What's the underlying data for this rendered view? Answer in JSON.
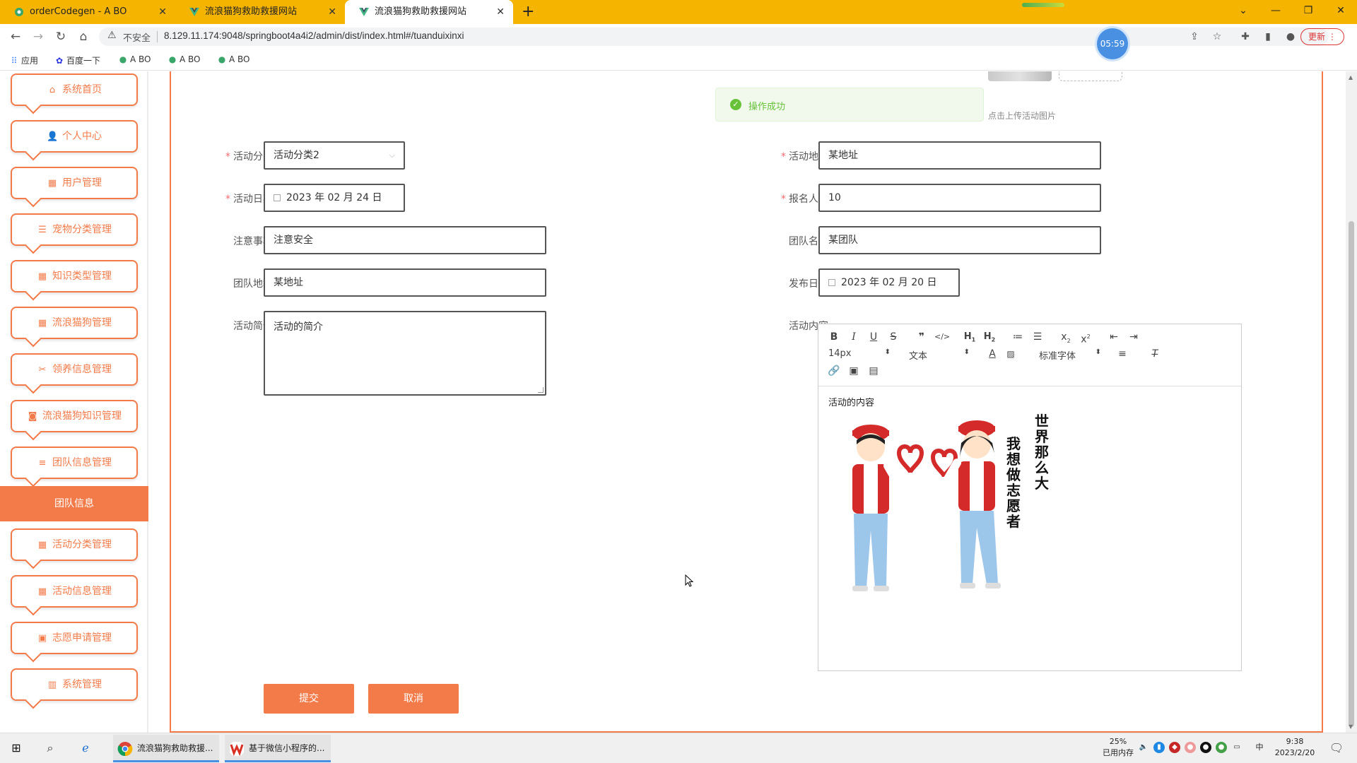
{
  "browser": {
    "tabs": [
      {
        "title": "orderCodegen - A BO"
      },
      {
        "title": "流浪猫狗救助救援网站"
      },
      {
        "title": "流浪猫狗救助救援网站"
      }
    ],
    "new_tab_symbol": "+",
    "insecure_label": "不安全",
    "url": "8.129.11.174:9048/springboot4a4i2/admin/dist/index.html#/tuanduixinxi",
    "timer": "05:59",
    "update_label": "更新",
    "bookmarks": [
      "应用",
      "百度一下",
      "A BO",
      "A BO",
      "A BO"
    ]
  },
  "sidebar": {
    "items": [
      {
        "label": "系统首页",
        "icon": "home-icon"
      },
      {
        "label": "个人中心",
        "icon": "user-icon"
      },
      {
        "label": "用户管理",
        "icon": "grid-icon"
      },
      {
        "label": "宠物分类管理",
        "icon": "list-icon"
      },
      {
        "label": "知识类型管理",
        "icon": "grid-icon"
      },
      {
        "label": "流浪猫狗管理",
        "icon": "grid-icon"
      },
      {
        "label": "领养信息管理",
        "icon": "ticket-icon"
      },
      {
        "label": "流浪猫狗知识管理",
        "icon": "camera-icon"
      },
      {
        "label": "团队信息管理",
        "icon": "sliders-icon"
      }
    ],
    "active_item": "团队信息",
    "items_after": [
      {
        "label": "活动分类管理",
        "icon": "grid-icon"
      },
      {
        "label": "活动信息管理",
        "icon": "grid-icon"
      },
      {
        "label": "志愿申请管理",
        "icon": "clipboard-icon"
      },
      {
        "label": "系统管理",
        "icon": "bar-chart-icon"
      }
    ],
    "accent_color": "#f37b4a"
  },
  "toast": {
    "message": "操作成功",
    "color": "#67c23a"
  },
  "upload": {
    "hint": "点击上传活动图片"
  },
  "form": {
    "activity_category": {
      "label": "活动分类",
      "value": "活动分类2"
    },
    "activity_date": {
      "label": "活动日期",
      "value": "2023 年 02 月 24 日"
    },
    "notes": {
      "label": "注意事项",
      "value": "注意安全"
    },
    "team_address": {
      "label": "团队地址",
      "value": "某地址"
    },
    "activity_intro": {
      "label": "活动简介",
      "value": "活动的简介"
    },
    "activity_address": {
      "label": "活动地址",
      "value": "某地址"
    },
    "signup_count": {
      "label": "报名人数",
      "value": "10"
    },
    "team_name": {
      "label": "团队名称",
      "value": "某团队"
    },
    "publish_date": {
      "label": "发布日期",
      "value": "2023 年 02 月 20 日"
    },
    "activity_content": {
      "label": "活动内容",
      "text": "活动的内容"
    }
  },
  "editor": {
    "font_size": "14px",
    "block_type": "文本",
    "font_family": "标准字体",
    "image_text_1": "世界那么大",
    "image_text_2": "我想做志愿者"
  },
  "buttons": {
    "submit": "提交",
    "cancel": "取消"
  },
  "taskbar": {
    "apps": [
      "流浪猫狗救助救援...",
      "基于微信小程序的..."
    ],
    "memory_percent": "25%",
    "memory_label": "已用内存",
    "ime": "中",
    "time": "9:38",
    "date": "2023/2/20"
  }
}
